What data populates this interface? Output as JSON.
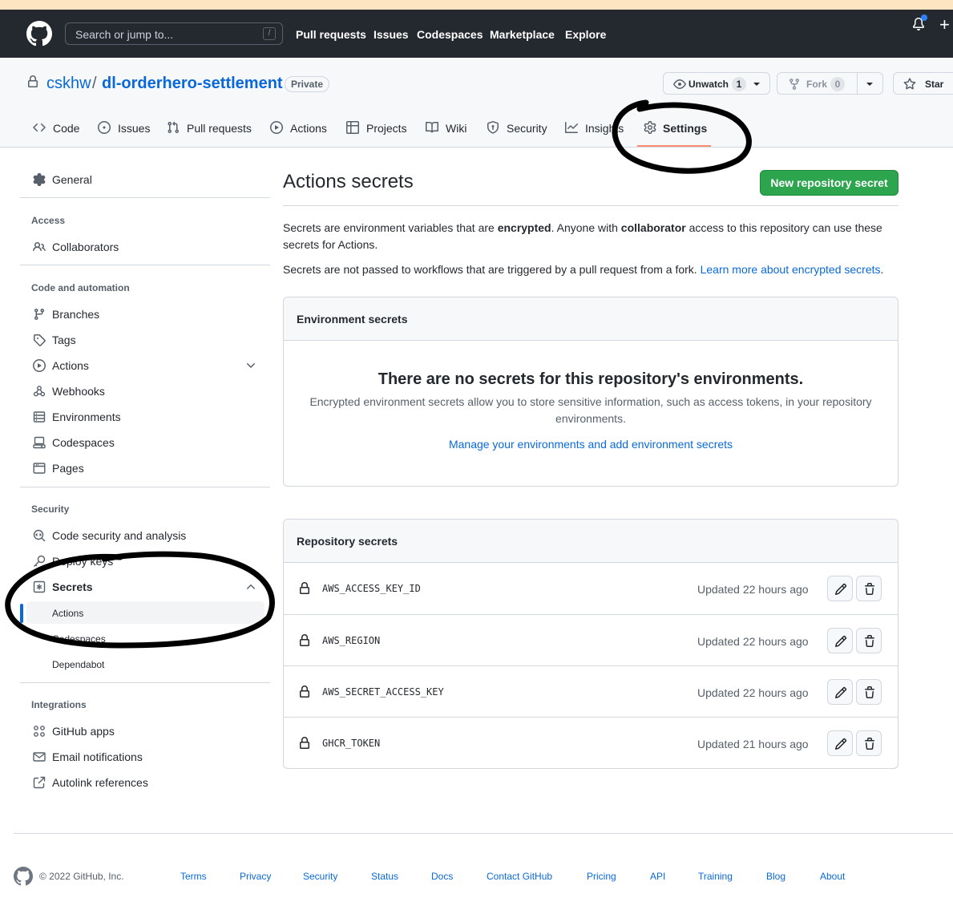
{
  "header": {
    "search_placeholder": "Search or jump to...",
    "search_shortcut": "/",
    "nav": [
      "Pull requests",
      "Issues",
      "Codespaces",
      "Marketplace",
      "Explore"
    ],
    "plus": "+"
  },
  "repo": {
    "owner": "cskhw",
    "separator": "/",
    "name": "dl-orderhero-settlement",
    "visibility": "Private",
    "unwatch_label": "Unwatch",
    "unwatch_count": "1",
    "fork_label": "Fork",
    "fork_count": "0",
    "star_label": "Star"
  },
  "tabs": [
    {
      "label": "Code",
      "icon": "code-icon"
    },
    {
      "label": "Issues",
      "icon": "issue-icon"
    },
    {
      "label": "Pull requests",
      "icon": "pull-request-icon"
    },
    {
      "label": "Actions",
      "icon": "play-icon"
    },
    {
      "label": "Projects",
      "icon": "table-icon"
    },
    {
      "label": "Wiki",
      "icon": "book-icon"
    },
    {
      "label": "Security",
      "icon": "shield-icon"
    },
    {
      "label": "Insights",
      "icon": "graph-icon"
    },
    {
      "label": "Settings",
      "icon": "gear-icon"
    }
  ],
  "sidebar": {
    "general": "General",
    "access_heading": "Access",
    "collaborators": "Collaborators",
    "code_heading": "Code and automation",
    "code_items": [
      "Branches",
      "Tags",
      "Actions",
      "Webhooks",
      "Environments",
      "Codespaces",
      "Pages"
    ],
    "security_heading": "Security",
    "code_security": "Code security and analysis",
    "deploy_keys": "Deploy keys",
    "secrets": "Secrets",
    "secrets_sub": [
      "Actions",
      "Codespaces",
      "Dependabot"
    ],
    "integrations_heading": "Integrations",
    "integration_items": [
      "GitHub apps",
      "Email notifications",
      "Autolink references"
    ]
  },
  "main": {
    "title": "Actions secrets",
    "new_button": "New repository secret",
    "para1_a": "Secrets are environment variables that are ",
    "para1_b": "encrypted",
    "para1_c": ". Anyone with ",
    "para1_d": "collaborator",
    "para1_e": " access to this repository can use these secrets for Actions.",
    "para2": "Secrets are not passed to workflows that are triggered by a pull request from a fork. ",
    "para2_link": "Learn more about encrypted secrets",
    "para2_end": ".",
    "env_heading": "Environment secrets",
    "env_empty_title": "There are no secrets for this repository's environments.",
    "env_empty_desc": "Encrypted environment secrets allow you to store sensitive information, such as access tokens, in your repository environments.",
    "env_link": "Manage your environments and add environment secrets",
    "repo_heading": "Repository secrets",
    "secrets": [
      {
        "name": "AWS_ACCESS_KEY_ID",
        "updated": "Updated 22 hours ago"
      },
      {
        "name": "AWS_REGION",
        "updated": "Updated 22 hours ago"
      },
      {
        "name": "AWS_SECRET_ACCESS_KEY",
        "updated": "Updated 22 hours ago"
      },
      {
        "name": "GHCR_TOKEN",
        "updated": "Updated 21 hours ago"
      }
    ]
  },
  "footer": {
    "copyright": "© 2022 GitHub, Inc.",
    "links": [
      "Terms",
      "Privacy",
      "Security",
      "Status",
      "Docs",
      "Contact GitHub",
      "Pricing",
      "API",
      "Training",
      "Blog",
      "About"
    ]
  },
  "colors": {
    "header_bg": "#24292f",
    "link": "#0969da",
    "primary_button": "#2da44e",
    "tab_underline": "#fd8c73"
  }
}
